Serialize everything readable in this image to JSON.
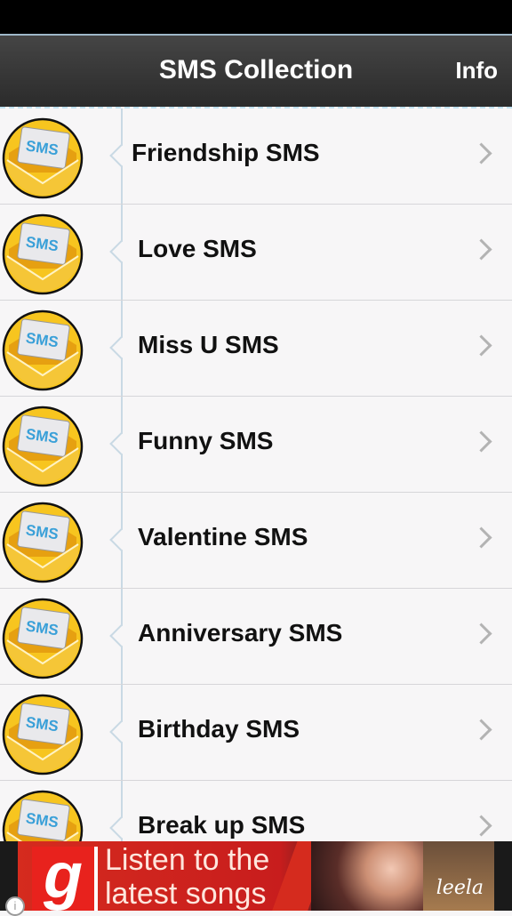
{
  "nav": {
    "title": "SMS Collection",
    "info_label": "Info"
  },
  "icon_badge_text": "SMS",
  "categories": [
    {
      "label": "Friendship SMS"
    },
    {
      "label": "Love SMS"
    },
    {
      "label": "Miss U SMS"
    },
    {
      "label": "Funny SMS"
    },
    {
      "label": "Valentine SMS"
    },
    {
      "label": "Anniversary SMS"
    },
    {
      "label": "Birthday SMS"
    },
    {
      "label": "Break up SMS"
    }
  ],
  "ad": {
    "logo_letter": "g",
    "text_line1": "Listen to the",
    "text_line2": "latest songs",
    "poster_text": "leela",
    "info_glyph": "i"
  },
  "colors": {
    "nav_bg": "#333333",
    "icon_yellow": "#f7c51f",
    "ad_red": "#d52b1e"
  }
}
